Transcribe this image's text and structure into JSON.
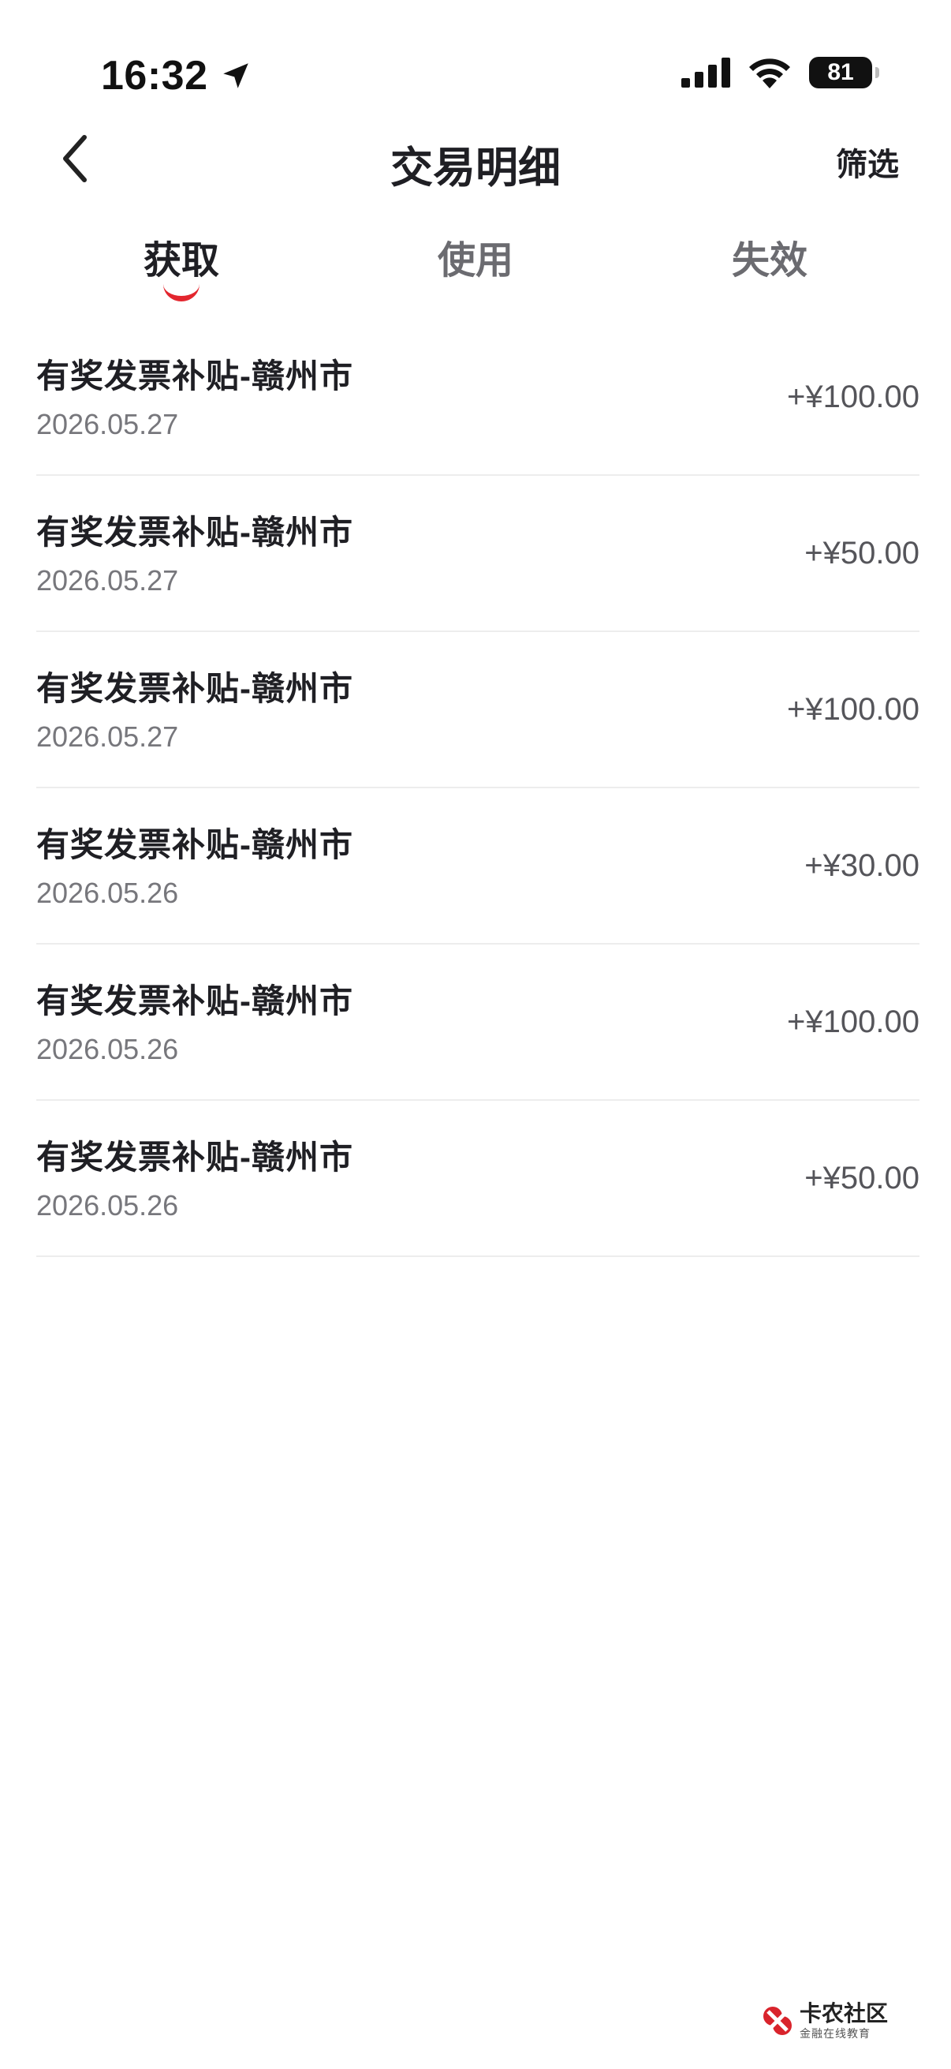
{
  "status_bar": {
    "time": "16:32",
    "battery": "81"
  },
  "nav": {
    "title": "交易明细",
    "filter_label": "筛选"
  },
  "tabs": [
    {
      "label": "获取",
      "active": true
    },
    {
      "label": "使用",
      "active": false
    },
    {
      "label": "失效",
      "active": false
    }
  ],
  "colors": {
    "accent": "#e3262e",
    "text_primary": "#1f1f24",
    "text_secondary": "#77777c",
    "divider": "#ededed"
  },
  "transactions": [
    {
      "title": "有奖发票补贴-赣州市",
      "date": "2026.05.27",
      "amount": "+¥100.00"
    },
    {
      "title": "有奖发票补贴-赣州市",
      "date": "2026.05.27",
      "amount": "+¥50.00"
    },
    {
      "title": "有奖发票补贴-赣州市",
      "date": "2026.05.27",
      "amount": "+¥100.00"
    },
    {
      "title": "有奖发票补贴-赣州市",
      "date": "2026.05.26",
      "amount": "+¥30.00"
    },
    {
      "title": "有奖发票补贴-赣州市",
      "date": "2026.05.26",
      "amount": "+¥100.00"
    },
    {
      "title": "有奖发票补贴-赣州市",
      "date": "2026.05.26",
      "amount": "+¥50.00"
    }
  ],
  "watermark": {
    "title": "卡农社区",
    "subtitle": "金融在线教育"
  },
  "icons": {
    "location": "location-arrow-icon",
    "signal": "cellular-signal-icon",
    "wifi": "wifi-icon",
    "back": "chevron-left-icon"
  }
}
